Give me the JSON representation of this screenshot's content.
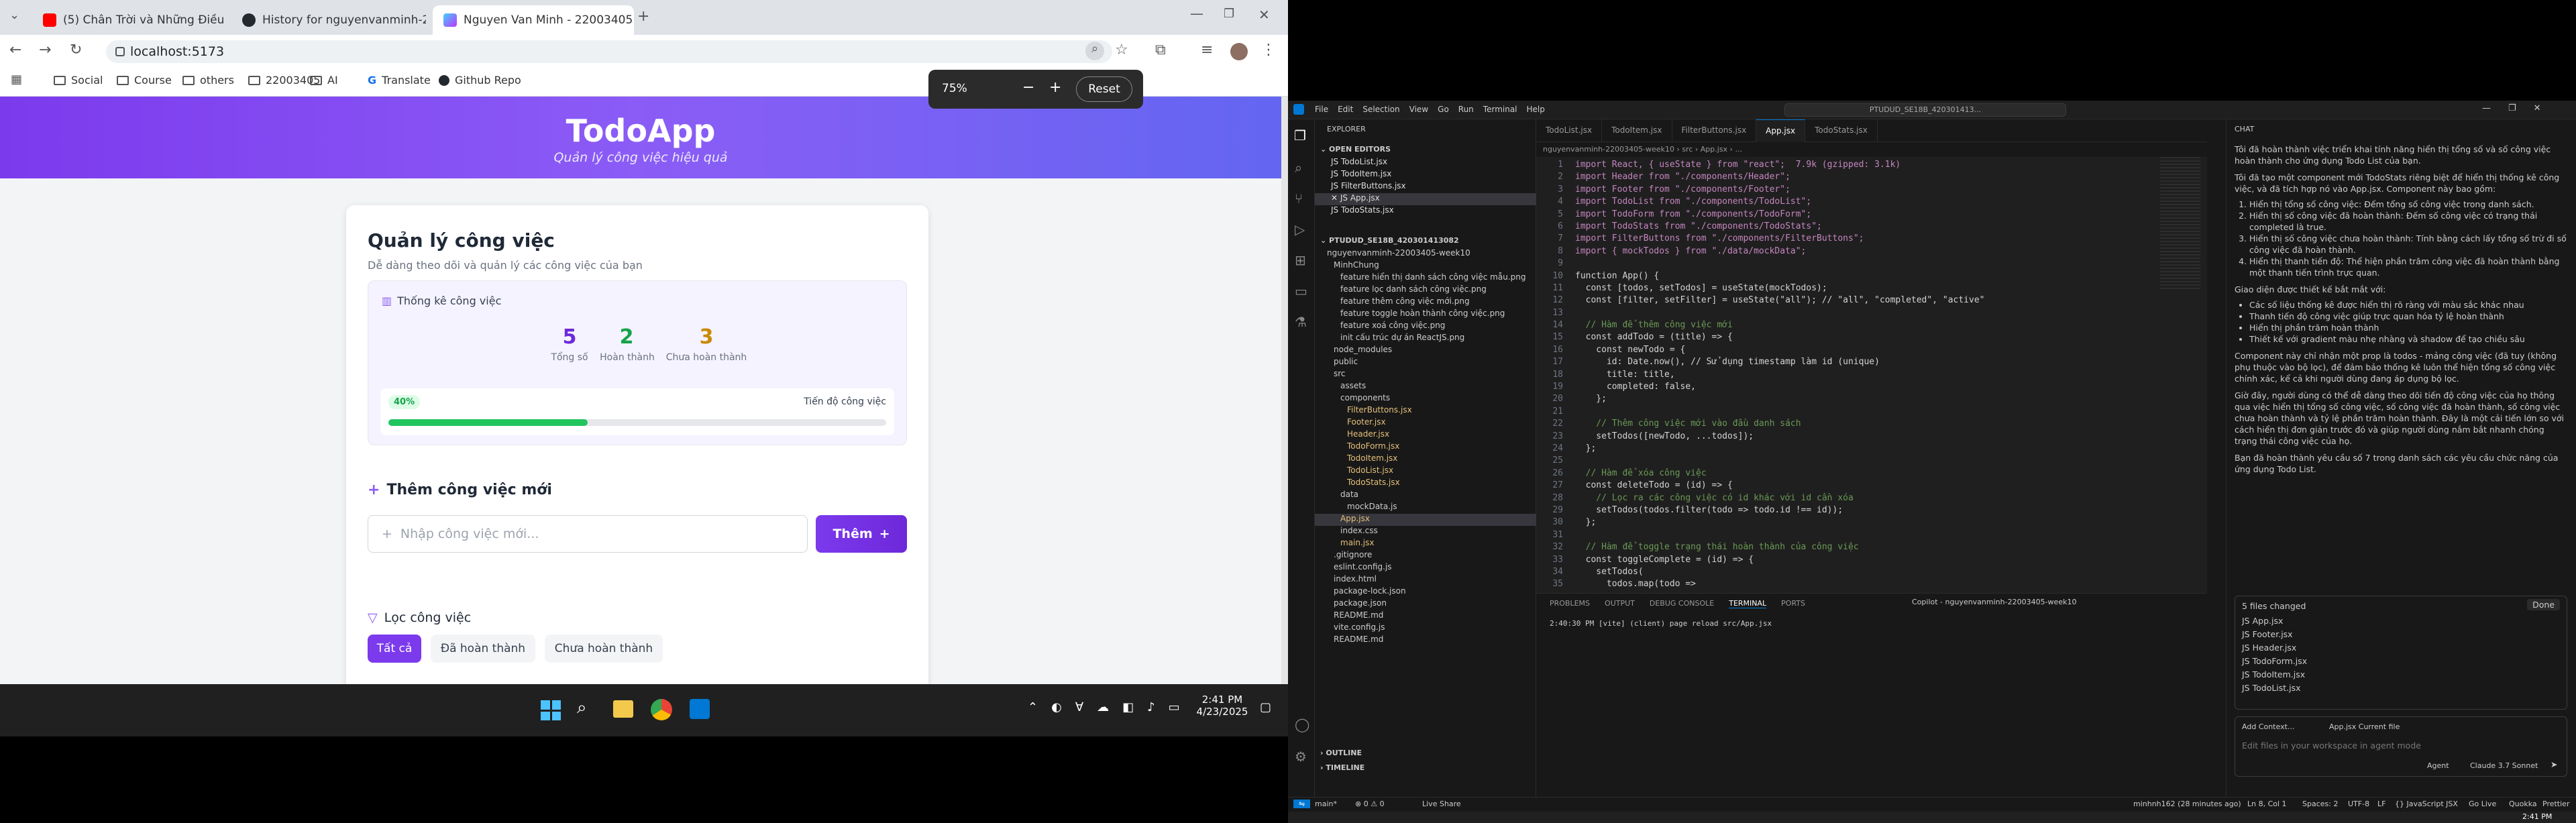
{
  "browser": {
    "tabs": [
      "(5) Chân Trời và Những Điều",
      "History for nguyenvanminh-22003405",
      "Nguyen Van Minh - 22003405"
    ],
    "url": "localhost:5173",
    "bookmarks": [
      "Social",
      "Course",
      "others",
      "22003405",
      "AI",
      "Translate",
      "Github Repo"
    ],
    "zoom": {
      "value": "75%",
      "minus": "−",
      "plus": "+",
      "reset": "Reset"
    }
  },
  "app": {
    "title": "TodoApp",
    "subtitle": "Quản lý công việc hiệu quả",
    "card_title": "Quản lý công việc",
    "card_desc": "Dễ dàng theo dõi và quản lý các công việc của bạn",
    "stats": {
      "heading": "Thống kê công việc",
      "total": "5",
      "total_label": "Tổng số",
      "done": "2",
      "done_label": "Hoàn thành",
      "todo": "3",
      "todo_label": "Chưa hoàn thành",
      "percent_label": "40%",
      "percent_value": 40,
      "progress_label": "Tiến độ công việc"
    },
    "add": {
      "heading": "Thêm công việc mới",
      "placeholder": "Nhập công việc mới...",
      "button": "Thêm"
    },
    "filter": {
      "heading": "Lọc công việc",
      "options": [
        "Tất cả",
        "Đã hoàn thành",
        "Chưa hoàn thành"
      ]
    }
  },
  "taskbar": {
    "time": "2:41 PM",
    "date": "4/23/2025"
  },
  "vscode": {
    "menu": [
      "File",
      "Edit",
      "Selection",
      "View",
      "Go",
      "Run",
      "Terminal",
      "Help"
    ],
    "search": "PTUDUD_SE18B_420301413...",
    "tabs": [
      "TodoList.jsx",
      "TodoItem.jsx",
      "FilterButtons.jsx",
      "App.jsx",
      "TodoStats.jsx"
    ],
    "explorer_title": "EXPLORER",
    "open_editors_label": "OPEN EDITORS",
    "open_editors": [
      "TodoList.jsx",
      "TodoItem.jsx",
      "FilterButtons.jsx",
      "App.jsx",
      "TodoStats.jsx"
    ],
    "project": "PTUDUD_SE18B_420301413082",
    "tree": [
      "nguyenvanminh-22003405-week10",
      "MinhChung",
      "feature hiển thị danh sách công việc mẫu.png",
      "feature lọc danh sách công việc.png",
      "feature thêm công việc mới.png",
      "feature toggle hoàn thành công việc.png",
      "feature xoá công việc.png",
      "init cấu trúc dự án ReactJS.png",
      "node_modules",
      "public",
      "src",
      "assets",
      "components",
      "FilterButtons.jsx",
      "Footer.jsx",
      "Header.jsx",
      "TodoForm.jsx",
      "TodoItem.jsx",
      "TodoList.jsx",
      "TodoStats.jsx",
      "data",
      "mockData.js",
      "App.jsx",
      "index.css",
      "main.jsx",
      ".gitignore",
      "eslint.config.js",
      "index.html",
      "package-lock.json",
      "package.json",
      "README.md",
      "vite.config.js",
      "README.md"
    ],
    "outline": "OUTLINE",
    "timeline": "TIMELINE",
    "breadcrumb": "nguyenvanminh-22003405-week10 › src › App.jsx › ...",
    "code": [
      "import React, { useState } from \"react\";  7.9k (gzipped: 3.1k)",
      "import Header from \"./components/Header\";",
      "import Footer from \"./components/Footer\";",
      "import TodoList from \"./components/TodoList\";",
      "import TodoForm from \"./components/TodoForm\";",
      "import TodoStats from \"./components/TodoStats\";",
      "import FilterButtons from \"./components/FilterButtons\";",
      "import { mockTodos } from \"./data/mockData\";",
      "",
      "function App() {",
      "  const [todos, setTodos] = useState(mockTodos);",
      "  const [filter, setFilter] = useState(\"all\"); // \"all\", \"completed\", \"active\"",
      "",
      "  // Hàm để thêm công việc mới",
      "  const addTodo = (title) => {",
      "    const newTodo = {",
      "      id: Date.now(), // Sử dụng timestamp làm id (unique)",
      "      title: title,",
      "      completed: false,",
      "    };",
      "",
      "    // Thêm công việc mới vào đầu danh sách",
      "    setTodos([newTodo, ...todos]);",
      "  };",
      "",
      "  // Hàm để xóa công việc",
      "  const deleteTodo = (id) => {",
      "    // Lọc ra các công việc có id khác với id cần xóa",
      "    setTodos(todos.filter(todo => todo.id !== id));",
      "  };",
      "",
      "  // Hàm để toggle trạng thái hoàn thành của công việc",
      "  const toggleComplete = (id) => {",
      "    setTodos(",
      "      todos.map(todo =>"
    ],
    "panel_tabs": [
      "PROBLEMS",
      "OUTPUT",
      "DEBUG CONSOLE",
      "TERMINAL",
      "PORTS"
    ],
    "terminal_line": "2:40:30 PM [vite] (client) page reload src/App.jsx",
    "copilot_label": "Copilot - nguyenvanminh-22003405-week10",
    "status": {
      "branch": "main*",
      "errors": "⊗ 0 ⚠ 0",
      "live_share": "Live Share",
      "user": "minhnh162 (28 minutes ago)",
      "pos": "Ln 8, Col 1",
      "spaces": "Spaces: 2",
      "enc": "UTF-8",
      "eol": "LF",
      "lang": "{} JavaScript JSX",
      "golive": "Go Live",
      "quokka": "Quokka",
      "prettier": "Prettier"
    },
    "chat": {
      "title": "CHAT",
      "p1": "Tôi đã hoàn thành việc triển khai tính năng hiển thị tổng số và số công việc hoàn thành cho ứng dụng Todo List của bạn.",
      "p2": "Tôi đã tạo một component mới TodoStats riêng biệt để hiển thị thống kê công việc, và đã tích hợp nó vào App.jsx. Component này bao gồm:",
      "list1": [
        "Hiển thị tổng số công việc: Đếm tổng số công việc trong danh sách.",
        "Hiển thị số công việc đã hoàn thành: Đếm số công việc có trạng thái completed là true.",
        "Hiển thị số công việc chưa hoàn thành: Tính bằng cách lấy tổng số trừ đi số công việc đã hoàn thành.",
        "Hiển thị thanh tiến độ: Thể hiện phần trăm công việc đã hoàn thành bằng một thanh tiến trình trực quan."
      ],
      "p3": "Giao diện được thiết kế bắt mắt với:",
      "list2": [
        "Các số liệu thống kê được hiển thị rõ ràng với màu sắc khác nhau",
        "Thanh tiến độ công việc giúp trực quan hóa tỷ lệ hoàn thành",
        "Hiển thị phần trăm hoàn thành",
        "Thiết kế với gradient màu nhẹ nhàng và shadow để tạo chiều sâu"
      ],
      "p4": "Component này chỉ nhận một prop là todos - mảng công việc (đã tuy (không phụ thuộc vào bộ lọc), để đảm bảo thống kê luôn thể hiện tổng số công việc chính xác, kể cả khi người dùng đang áp dụng bộ lọc.",
      "p5": "Giờ đây, người dùng có thể dễ dàng theo dõi tiến độ công việc của họ thông qua việc hiển thị tổng số công việc, số công việc đã hoàn thành, số công việc chưa hoàn thành và tỷ lệ phần trăm hoàn thành. Đây là một cải tiến lớn so với cách hiển thị đơn giản trước đó và giúp người dùng nắm bắt nhanh chóng trạng thái công việc của họ.",
      "p6": "Bạn đã hoàn thành yêu cầu số 7 trong danh sách các yêu cầu chức năng của ứng dụng Todo List.",
      "files_changed": "5 files changed",
      "done": "Done",
      "files": [
        "App.jsx",
        "Footer.jsx",
        "Header.jsx",
        "TodoForm.jsx",
        "TodoItem.jsx",
        "TodoList.jsx"
      ],
      "add_context": "Add Context...",
      "current": "App.jsx Current file",
      "input_placeholder": "Edit files in your workspace in agent mode",
      "agent": "Agent",
      "model": "Claude 3.7 Sonnet"
    },
    "taskbar_time": "2:41 PM",
    "taskbar_date": "4/23/2025"
  }
}
